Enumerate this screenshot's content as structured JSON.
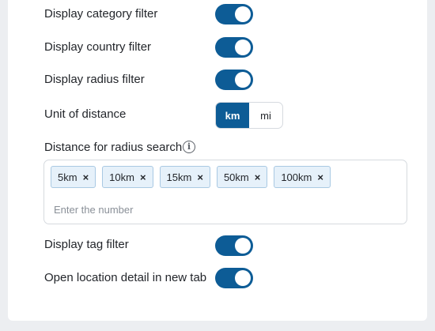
{
  "settings": {
    "category_filter": {
      "label": "Display category filter",
      "enabled": true
    },
    "country_filter": {
      "label": "Display country filter",
      "enabled": true
    },
    "radius_filter": {
      "label": "Display radius filter",
      "enabled": true
    },
    "unit": {
      "label": "Unit of distance",
      "options": [
        "km",
        "mi"
      ],
      "selected": "km"
    },
    "radius_search": {
      "label": "Distance for radius search",
      "info_icon": "info-icon",
      "tags": [
        "5km",
        "10km",
        "15km",
        "50km",
        "100km"
      ],
      "remove_glyph": "×",
      "input_placeholder": "Enter the number",
      "input_value": ""
    },
    "tag_filter": {
      "label": "Display tag filter",
      "enabled": true
    },
    "open_new_tab": {
      "label": "Open location detail in new tab",
      "enabled": true
    }
  },
  "colors": {
    "accent": "#0d5c96",
    "chip_bg": "#e6f1fa",
    "chip_border": "#a9c9e3",
    "page_bg": "#eceef1"
  }
}
